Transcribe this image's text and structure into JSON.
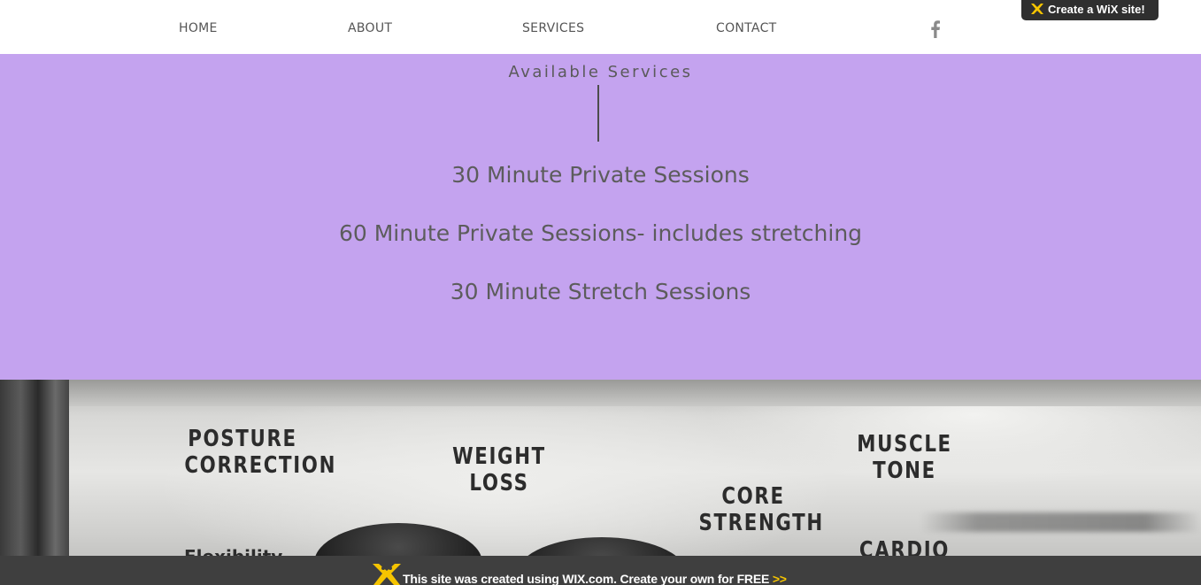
{
  "nav": {
    "items": [
      {
        "label": "HOME"
      },
      {
        "label": "ABOUT"
      },
      {
        "label": "SERVICES"
      },
      {
        "label": "CONTACT"
      }
    ],
    "social_icon": "facebook-icon"
  },
  "wix_badge": {
    "label": "Create a WiX site!",
    "icon": "wix-logo-icon"
  },
  "services": {
    "title": "Available Services",
    "background": "#c4a3ef",
    "items": [
      {
        "label": "30 Minute Private Sessions"
      },
      {
        "label": "60 Minute Private Sessions- includes stretching"
      },
      {
        "label": "30 Minute Stretch Sessions"
      }
    ]
  },
  "hero": {
    "labels": [
      {
        "line1": "POSTURE",
        "line2": "CORRECTION"
      },
      {
        "line1": "WEIGHT",
        "line2": "LOSS"
      },
      {
        "line1": "CORE",
        "line2": "STRENGTH"
      },
      {
        "line1": "MUSCLE",
        "line2": "TONE"
      },
      {
        "line1": "CARDIO"
      }
    ],
    "small_label": "Flexibility"
  },
  "wix_banner": {
    "text": "This site was created using WIX.com. Create your own for FREE",
    "arrow": ">>",
    "arrow_color": "#f5c400",
    "icon": "wix-mascot-icon"
  }
}
